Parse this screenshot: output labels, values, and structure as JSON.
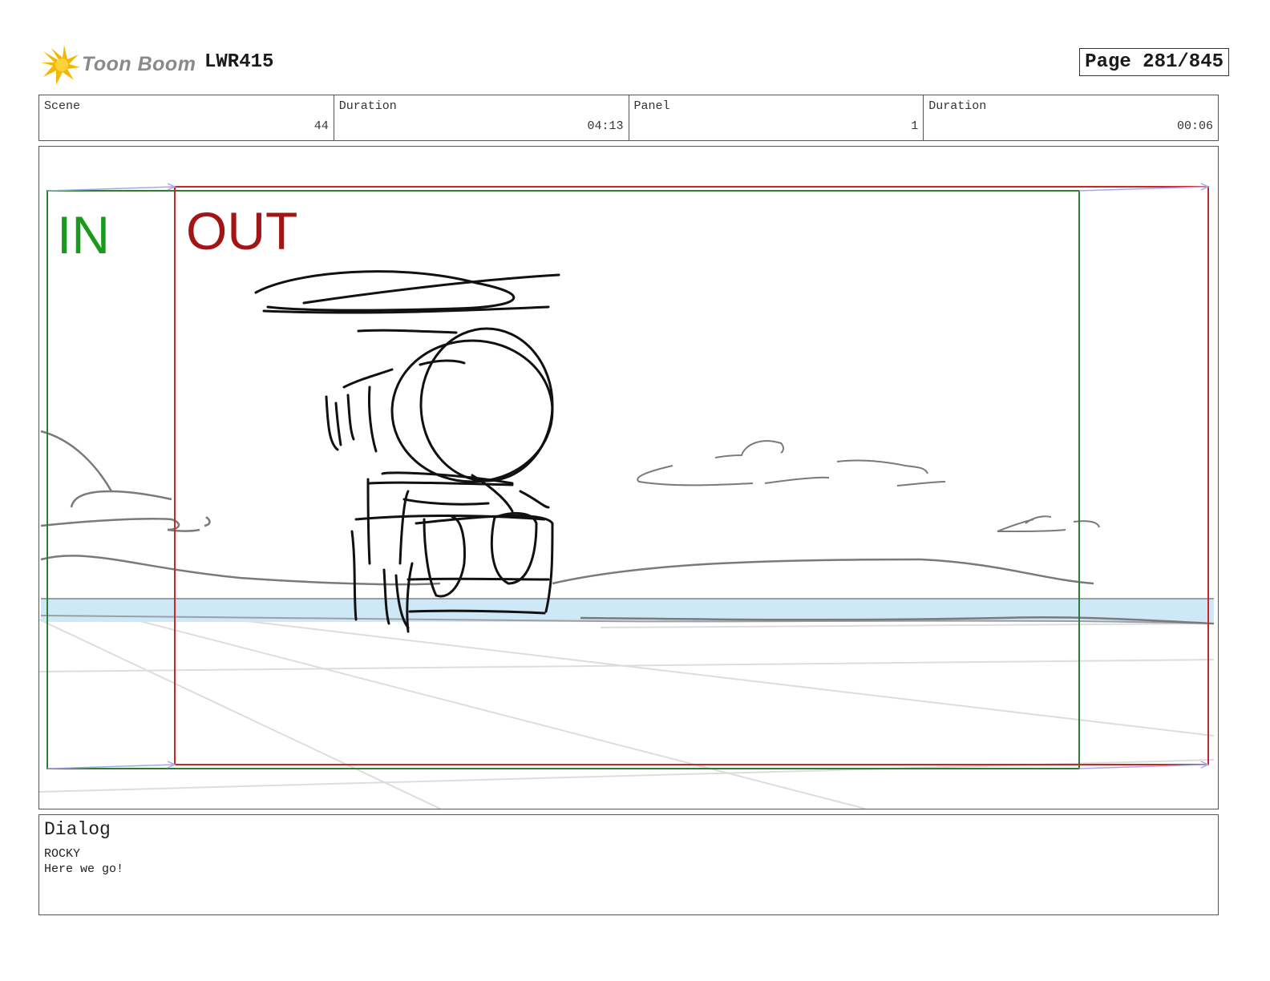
{
  "header": {
    "logo_text": "Toon Boom",
    "project_code": "LWR415",
    "page_label": "Page 281/845"
  },
  "info": {
    "scene_label": "Scene",
    "scene_value": "44",
    "scene_duration_label": "Duration",
    "scene_duration_value": "04:13",
    "panel_label": "Panel",
    "panel_value": "1",
    "panel_duration_label": "Duration",
    "panel_duration_value": "00:06"
  },
  "panel_view": {
    "in_label": "IN",
    "out_label": "OUT",
    "in_color": "#1a9a1a",
    "out_color": "#a31515",
    "in_frame_color": "#2e7d32",
    "out_frame_color": "#c62828",
    "water_color": "#cfe8f7"
  },
  "dialog": {
    "title": "Dialog",
    "character": "ROCKY",
    "line": "Here we go!"
  }
}
